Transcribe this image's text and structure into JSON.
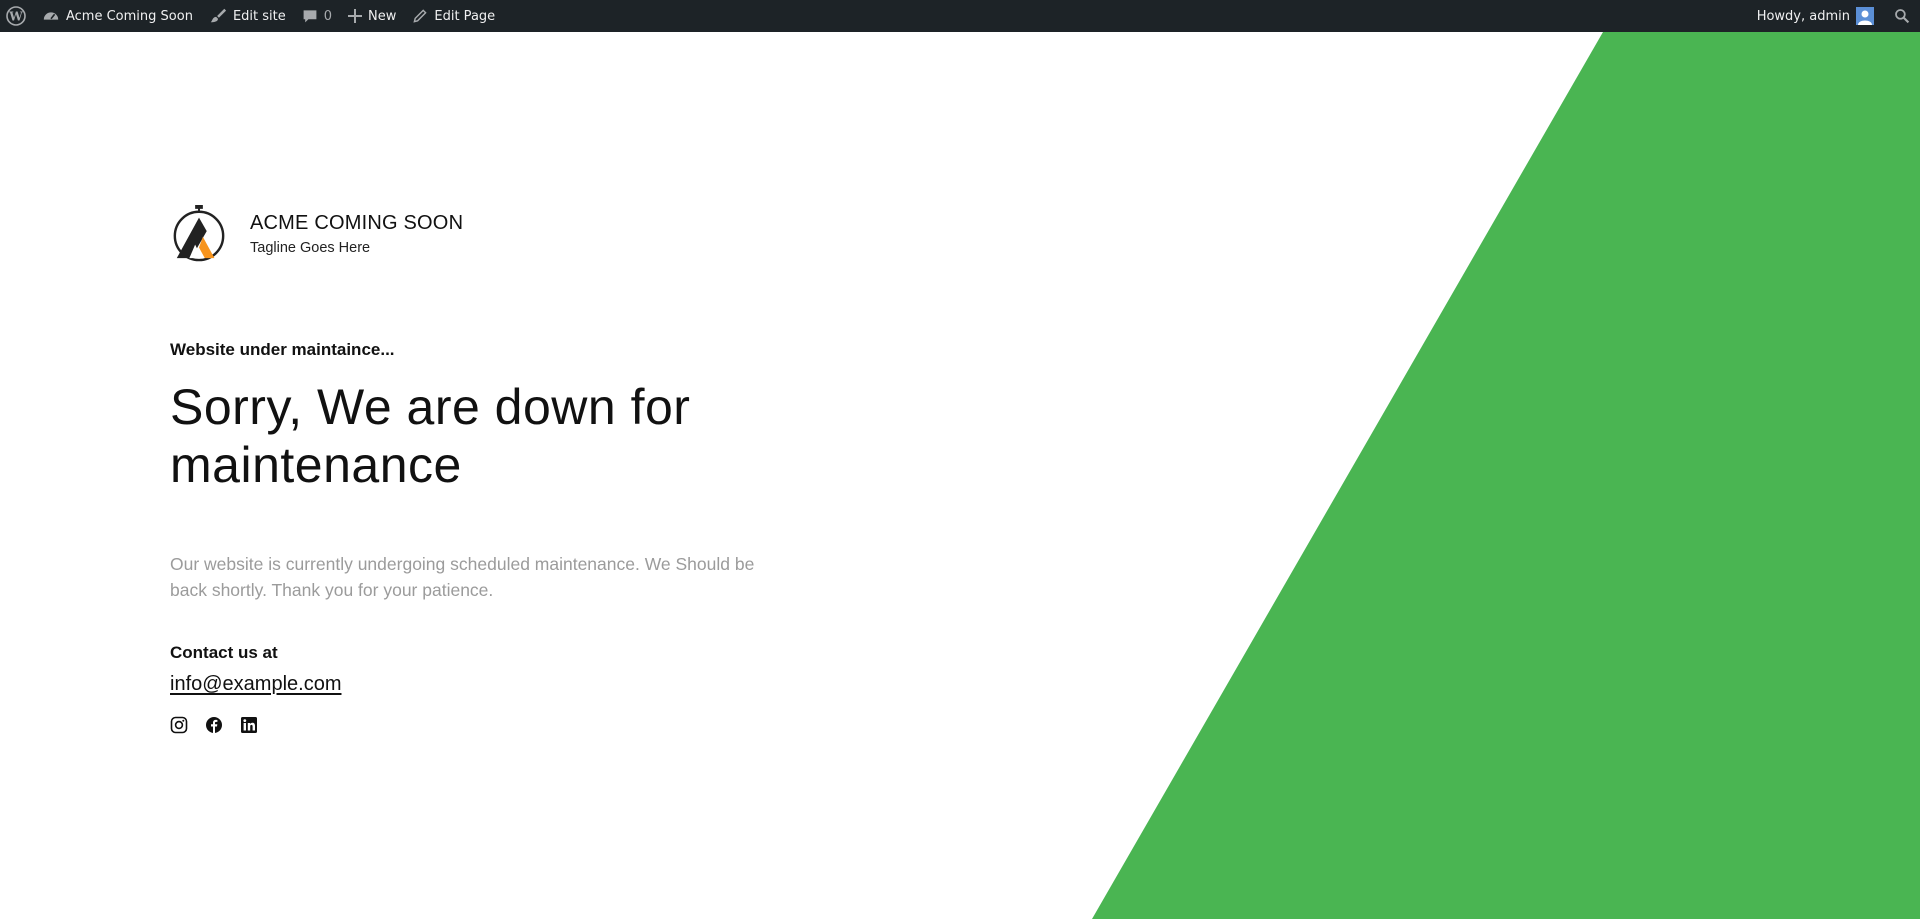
{
  "admin_bar": {
    "site_name": "Acme Coming Soon",
    "edit_site": "Edit site",
    "comments_count": "0",
    "new_label": "New",
    "edit_page": "Edit Page",
    "greeting": "Howdy, admin",
    "icons": {
      "wordpress": "wordpress-logo-icon",
      "dashboard": "dashboard-gauge-icon",
      "edit_site": "brush-icon",
      "comments": "comment-bubble-icon",
      "new": "plus-icon",
      "edit_page": "pencil-icon",
      "search": "search-icon"
    }
  },
  "brand": {
    "title": "ACME COMING SOON",
    "tagline": "Tagline Goes Here"
  },
  "main": {
    "eyebrow": "Website under maintaince...",
    "headline": "Sorry, We are down for maintenance",
    "description": "Our website is currently undergoing scheduled maintenance. We Should be back shortly. Thank you for your patience.",
    "contact_label": "Contact us at",
    "contact_email": "info@example.com"
  },
  "socials": [
    {
      "icon": "instagram-icon"
    },
    {
      "icon": "facebook-icon"
    },
    {
      "icon": "linkedin-icon"
    }
  ],
  "colors": {
    "accent_green": "#4ab552",
    "admin_bar_bg": "#1d2327",
    "logo_orange": "#f7941d",
    "description_text": "#9b9b9b"
  }
}
